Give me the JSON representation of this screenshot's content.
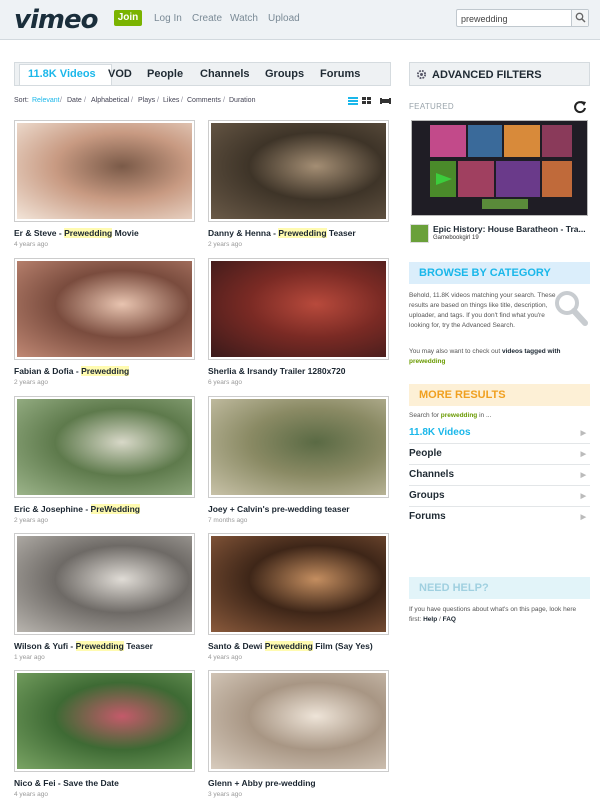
{
  "header": {
    "logo": "vimeo",
    "join": "Join",
    "nav": [
      "Log In",
      "Create",
      "Watch",
      "Upload"
    ],
    "search_value": "prewedding"
  },
  "tabs": [
    "11.8K Videos",
    "VOD",
    "People",
    "Channels",
    "Groups",
    "Forums"
  ],
  "sort": {
    "label": "Sort:",
    "options": [
      "Relevant",
      "Date",
      "Alphabetical",
      "Plays",
      "Likes",
      "Comments",
      "Duration"
    ],
    "active": "Relevant"
  },
  "videos": [
    {
      "title_pre": "Er & Steve - ",
      "title_hl": "Prewedding",
      "title_post": " Movie",
      "meta": "4 years ago",
      "palette": [
        "#f2e4d8",
        "#c89a82",
        "#7a5a48"
      ]
    },
    {
      "title_pre": "Danny & Henna - ",
      "title_hl": "Prewedding",
      "title_post": " Teaser",
      "meta": "2 years ago",
      "palette": [
        "#6a5a48",
        "#3e3428",
        "#a48e74"
      ]
    },
    {
      "title_pre": "Fabian & Dofia - ",
      "title_hl": "Prewedding",
      "title_post": "",
      "meta": "2 years ago",
      "palette": [
        "#c08874",
        "#7a4c3e",
        "#e8c4b0"
      ]
    },
    {
      "title_pre": "Sherlia & Irsandy Trailer 1280x720",
      "title_hl": "",
      "title_post": "",
      "meta": "6 years ago",
      "palette": [
        "#3a1a1a",
        "#7a2a24",
        "#b84a3c"
      ]
    },
    {
      "title_pre": "Eric & Josephine - ",
      "title_hl": "PreWedding",
      "title_post": "",
      "meta": "2 years ago",
      "palette": [
        "#9cb48a",
        "#5e7a4c",
        "#d8d8c8"
      ]
    },
    {
      "title_pre": "Joey + Calvin's pre-wedding teaser",
      "title_hl": "",
      "title_post": "",
      "meta": "7 months ago",
      "palette": [
        "#c8c2a8",
        "#8a8a64",
        "#5a6a44"
      ]
    },
    {
      "title_pre": "Wilson & Yufi - ",
      "title_hl": "Prewedding",
      "title_post": " Teaser",
      "meta": "1 year ago",
      "palette": [
        "#b8b4ae",
        "#6e6a66",
        "#e0dcd6"
      ]
    },
    {
      "title_pre": "Santo & Dewi ",
      "title_hl": "Prewedding",
      "title_post": " Film (Say Yes)",
      "meta": "4 years ago",
      "palette": [
        "#8a5a3c",
        "#3e2618",
        "#c48e60"
      ]
    },
    {
      "title_pre": "Nico & Fei - Save the Date",
      "title_hl": "",
      "title_post": "",
      "meta": "4 years ago",
      "palette": [
        "#7aa464",
        "#3e6a34",
        "#c45a6a"
      ]
    },
    {
      "title_pre": "Glenn + Abby pre-wedding",
      "title_hl": "",
      "title_post": "",
      "meta": "3 years ago",
      "palette": [
        "#d8ccbe",
        "#a89684",
        "#eee4d8"
      ]
    }
  ],
  "sidebar": {
    "advanced": "ADVANCED FILTERS",
    "featured_label": "FEATURED",
    "featured_title": "Epic History: House Baratheon - Tra...",
    "featured_user": "Gamebookgirl 19",
    "featured_banner": "Epic History House Baratheon",
    "browse_head": "BROWSE BY CATEGORY",
    "browse_text": "Behold, 11.8K videos matching your search. These results are based on things like title, description, uploader, and tags. If you don't find what you're looking for, try the Advanced Search.",
    "browse_text2_pre": "You may also want to check out ",
    "browse_text2_bold": "videos tagged with",
    "browse_tag": "prewedding",
    "more_head": "MORE RESULTS",
    "more_search_pre": "Search for ",
    "more_search_tag": "prewedding",
    "more_search_post": " in ...",
    "more_items": [
      "11.8K Videos",
      "People",
      "Channels",
      "Groups",
      "Forums"
    ],
    "help_head": "NEED HELP?",
    "help_text_pre": "If you have questions about what's on this page, look here first: ",
    "help_link1": "Help",
    "help_sep": " / ",
    "help_link2": "FAQ"
  },
  "colors": {
    "accent": "#1ab7ea",
    "join": "#7ab300",
    "more": "#f0a020",
    "highlight": "#fffbb0"
  }
}
